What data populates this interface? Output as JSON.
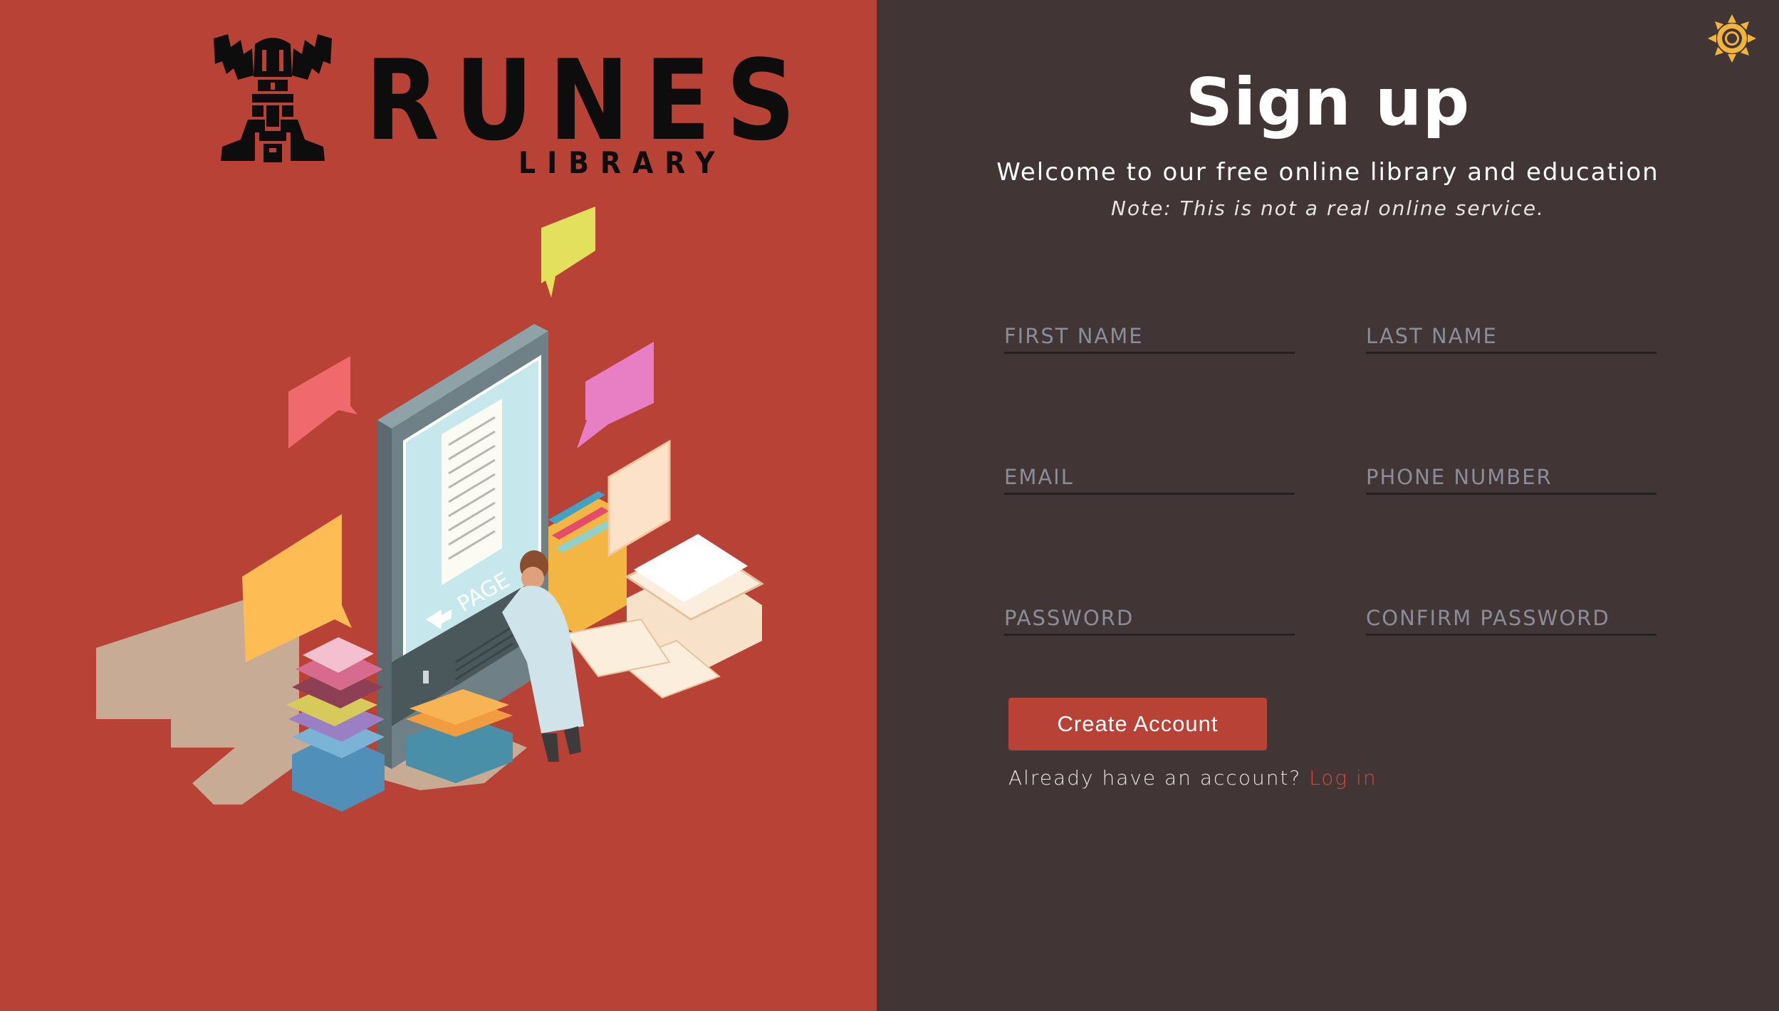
{
  "brand": {
    "name": "RUNES",
    "subname": "LIBRARY"
  },
  "theme_toggle": {
    "icon": "sun-icon"
  },
  "form": {
    "title": "Sign up",
    "subtitle": "Welcome to our free online library and education",
    "note": "Note: This is not a real online service.",
    "fields": {
      "first_name": {
        "placeholder": "FIRST NAME",
        "value": ""
      },
      "last_name": {
        "placeholder": "LAST NAME",
        "value": ""
      },
      "email": {
        "placeholder": "EMAIL",
        "value": ""
      },
      "phone": {
        "placeholder": "PHONE NUMBER",
        "value": ""
      },
      "password": {
        "placeholder": "PASSWORD",
        "value": ""
      },
      "confirm_password": {
        "placeholder": "CONFIRM PASSWORD",
        "value": ""
      }
    },
    "submit_label": "Create Account",
    "login_prompt": "Already have an account?",
    "login_link": "Log in"
  },
  "colors": {
    "accent_red": "#b84236",
    "panel_dark": "#413635",
    "link_red": "#d9473a",
    "sun_yellow": "#f2b53a"
  }
}
